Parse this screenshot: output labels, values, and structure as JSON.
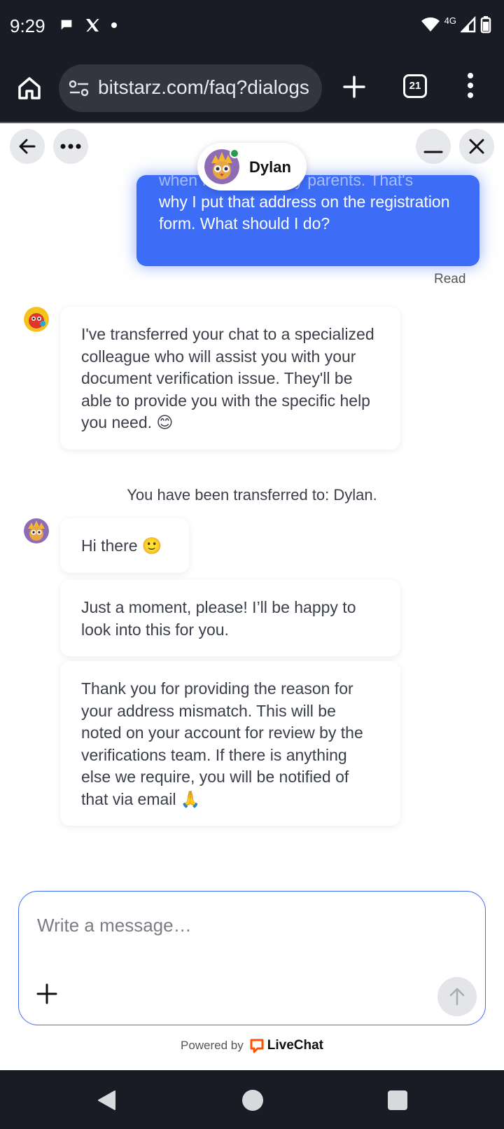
{
  "status_bar": {
    "time": "9:29",
    "network": "4G",
    "icons": [
      "chat-bubble-icon",
      "x-logo-icon",
      "dot-icon",
      "wifi-icon",
      "signal-icon",
      "battery-icon"
    ]
  },
  "browser": {
    "url": "bitstarz.com/faq?dialogs",
    "tab_count": "21"
  },
  "chat": {
    "agent_name": "Dylan",
    "user_message_partial": "when I lived with my parents. That's",
    "user_message": "why I put that address on the registration form. What should I do?",
    "read_status": "Read",
    "messages": [
      {
        "text": "I've transferred your chat to a specialized colleague who will assist you with your document verification issue. They'll be able to provide you with the specific help you need. 😊"
      },
      {
        "text": "You have been transferred to: Dylan."
      },
      {
        "text": "Hi there 🙂"
      },
      {
        "text": "Just a moment, please! I’ll be happy to look into this for you."
      },
      {
        "text": "Thank you for providing the reason for your address mismatch. This will be noted on your account for review by the verifications team. If there is anything else we require, you will be notified of that via email 🙏"
      }
    ]
  },
  "composer": {
    "placeholder": "Write a message…"
  },
  "footer": {
    "powered_by": "Powered by",
    "brand": "LiveChat"
  },
  "colors": {
    "accent": "#3d6cf7",
    "online": "#2b9b4b",
    "livechat": "#ff5100"
  }
}
